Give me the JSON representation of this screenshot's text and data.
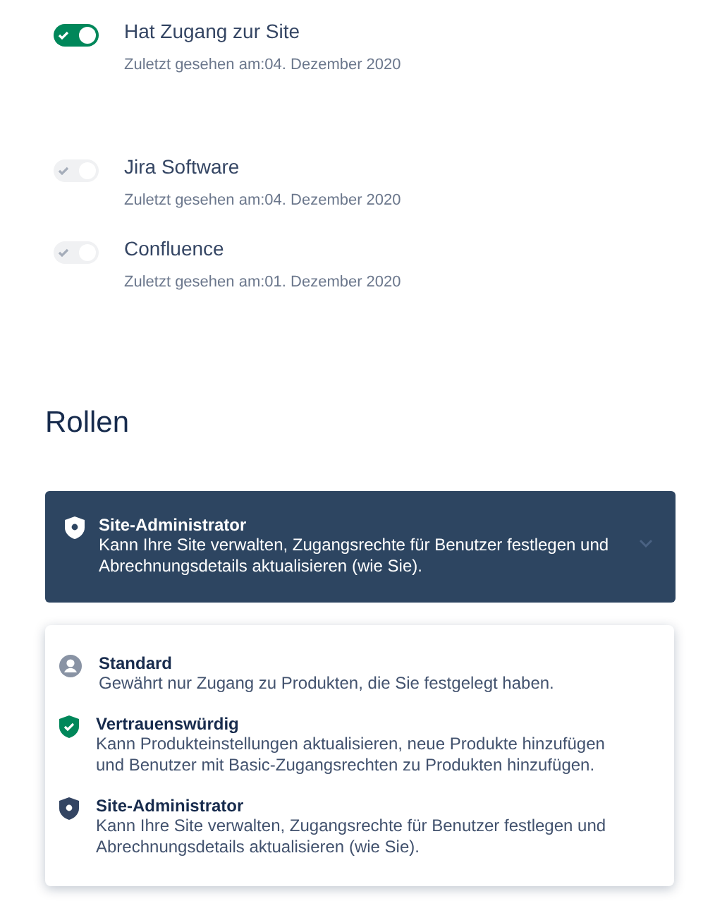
{
  "access": [
    {
      "name": "Hat Zugang zur Site",
      "last_seen": "Zuletzt gesehen am:04. Dezember 2020",
      "checked": true,
      "disabled": false
    },
    {
      "name": "Jira Software",
      "last_seen": "Zuletzt gesehen am:04. Dezember 2020",
      "checked": true,
      "disabled": true
    },
    {
      "name": "Confluence",
      "last_seen": "Zuletzt gesehen am:01. Dezember 2020",
      "checked": true,
      "disabled": true
    }
  ],
  "roles": {
    "heading": "Rollen",
    "select": {
      "kind": "admin",
      "title": "Site-Administrator",
      "description": "Kann Ihre Site verwalten, Zugangsrechte für Benutzer festlegen und Abrechnungsdetails aktualisieren (wie Sie)."
    },
    "options": [
      {
        "kind": "user",
        "title": "Standard",
        "description": "Gewährt nur Zugang zu Produkten, die Sie festgelegt haben."
      },
      {
        "kind": "trusted",
        "title": "Vertrauenswürdig",
        "description": "Kann Produkteinstellungen aktualisieren, neue Produkte hinzufügen und Benutzer mit Basic-Zugangsrechten zu Produkten hinzufügen."
      },
      {
        "kind": "admin",
        "title": "Site-Administrator",
        "description": "Kann Ihre Site verwalten, Zugangsrechte für Benutzer festlegen und Abrechnungsdetails aktualisieren (wie Sie)."
      }
    ]
  }
}
